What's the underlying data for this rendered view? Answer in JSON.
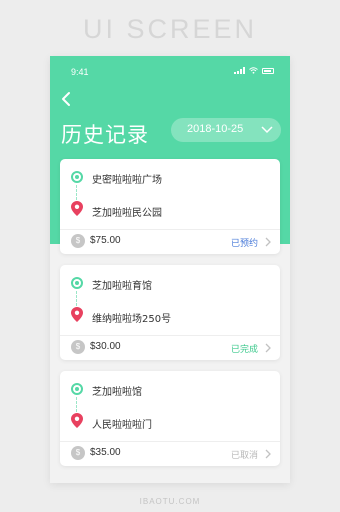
{
  "watermark": {
    "top": "UI SCREEN",
    "bottom": "IBAOTU.COM"
  },
  "status_bar": {
    "time": "9:41"
  },
  "header": {
    "title": "历史记录",
    "date": "2018-10-25"
  },
  "colors": {
    "brand": "#55d8a6",
    "status_booked": "#4a7bd9",
    "status_completed": "#3cc98c",
    "status_cancelled": "#b8b8b8",
    "pin": "#e8415f"
  },
  "orders": [
    {
      "from": "史密啦啦啦广场",
      "to": "芝加啦啦民公园",
      "price": "$75.00",
      "status": "已预约",
      "status_kind": "booked"
    },
    {
      "from": "芝加啦啦育馆",
      "to": "维纳啦啦场250号",
      "price": "$30.00",
      "status": "已完成",
      "status_kind": "completed"
    },
    {
      "from": "芝加啦啦馆",
      "to": "人民啦啦啦门",
      "price": "$35.00",
      "status": "已取消",
      "status_kind": "cancelled"
    }
  ],
  "icons": {
    "back": "back-arrow-icon",
    "date_dropdown": "chevron-down-icon",
    "origin": "origin-dot-icon",
    "destination": "location-pin-icon",
    "price": "dollar-coin-icon",
    "detail": "chevron-right-icon"
  }
}
